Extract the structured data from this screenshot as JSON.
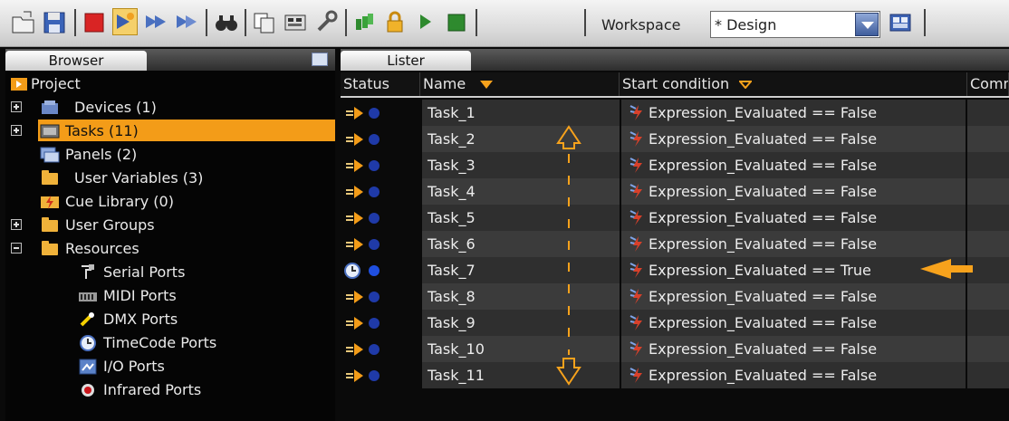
{
  "toolbar": {
    "workspace_label": "Workspace",
    "workspace_value": "* Design",
    "icons": [
      "open-folder-icon",
      "save-icon",
      "stop-icon",
      "run-icon",
      "step-icon",
      "step-next-icon",
      "find-icon",
      "copy-icon",
      "controller-icon",
      "wrench-icon",
      "tasks-icon",
      "lock-icon",
      "play-icon",
      "square-stop-icon",
      "workspace-settings-icon"
    ]
  },
  "browser": {
    "tab_label": "Browser",
    "items": [
      {
        "label": "Project",
        "icon": "project-icon"
      },
      {
        "label": "Devices (1)",
        "icon": "devices-icon"
      },
      {
        "label": "Tasks (11)",
        "icon": "tasks-icon",
        "selected": true
      },
      {
        "label": "Panels (2)",
        "icon": "panels-icon"
      },
      {
        "label": "User Variables (3)",
        "icon": "variables-icon"
      },
      {
        "label": "Cue Library (0)",
        "icon": "cue-library-icon"
      },
      {
        "label": "User Groups",
        "icon": "folder-icon"
      },
      {
        "label": "Resources",
        "icon": "folder-icon"
      },
      {
        "label": "Serial Ports",
        "icon": "serial-port-icon"
      },
      {
        "label": "MIDI Ports",
        "icon": "midi-port-icon"
      },
      {
        "label": "DMX Ports",
        "icon": "dmx-port-icon"
      },
      {
        "label": "TimeCode Ports",
        "icon": "clock-icon"
      },
      {
        "label": "I/O Ports",
        "icon": "io-port-icon"
      },
      {
        "label": "Infrared Ports",
        "icon": "infrared-port-icon"
      }
    ]
  },
  "lister": {
    "tab_label": "Lister",
    "columns": [
      "Status",
      "Name",
      "Start condition",
      "Comm"
    ],
    "rows": [
      {
        "name": "Task_1",
        "condition": "Expression_Evaluated == False",
        "status": "idle"
      },
      {
        "name": "Task_2",
        "condition": "Expression_Evaluated == False",
        "status": "idle"
      },
      {
        "name": "Task_3",
        "condition": "Expression_Evaluated == False",
        "status": "idle"
      },
      {
        "name": "Task_4",
        "condition": "Expression_Evaluated == False",
        "status": "idle"
      },
      {
        "name": "Task_5",
        "condition": "Expression_Evaluated == False",
        "status": "idle"
      },
      {
        "name": "Task_6",
        "condition": "Expression_Evaluated == False",
        "status": "idle"
      },
      {
        "name": "Task_7",
        "condition": "Expression_Evaluated == True",
        "status": "running"
      },
      {
        "name": "Task_8",
        "condition": "Expression_Evaluated == False",
        "status": "idle"
      },
      {
        "name": "Task_9",
        "condition": "Expression_Evaluated == False",
        "status": "idle"
      },
      {
        "name": "Task_10",
        "condition": "Expression_Evaluated == False",
        "status": "idle"
      },
      {
        "name": "Task_11",
        "condition": "Expression_Evaluated == False",
        "status": "idle"
      }
    ]
  },
  "annotations": {
    "color": "#f7a21c"
  }
}
